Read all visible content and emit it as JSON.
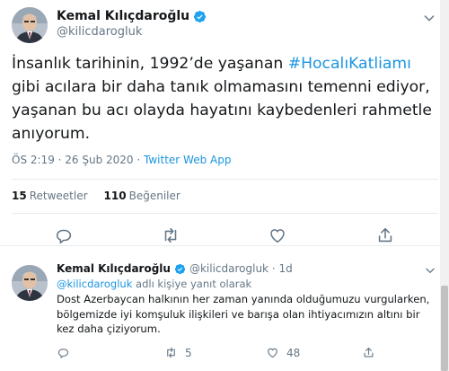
{
  "tweet": {
    "display_name": "Kemal Kılıçdaroğlu",
    "handle": "@kilicdarogluk",
    "text_before": "İnsanlık tarihinin, 1992’de yaşanan ",
    "hashtag": "#HocalıKatliamı",
    "text_after": " gibi acılara bir daha tanık olmamasını temenni ediyor, yaşanan bu acı olayda hayatını kaybedenleri rahmetle anıyorum.",
    "timestamp": "ÖS 2:19 · 26 Şub 2020 · ",
    "source": "Twitter Web App",
    "retweets_count": "15",
    "retweets_label": "Retweetler",
    "likes_count": "110",
    "likes_label": "Beğeniler",
    "verified_color": "#1da1f2",
    "icons": [
      "reply-icon",
      "retweet-icon",
      "like-icon",
      "share-icon",
      "chevron-down-icon",
      "verified-badge-icon"
    ]
  },
  "reply": {
    "display_name": "Kemal Kılıçdaroğlu",
    "handle": "@kilicdarogluk · 1d",
    "replying_link": "@kilicdarogluk",
    "replying_suffix": " adlı kişiye yanıt olarak",
    "text": "Dost Azerbaycan halkının her zaman yanında olduğumuzu vurgularken, bölgemizde iyi komşuluk ilişkileri ve barışa olan ihtiyacımızın altını bir kez daha çiziyorum.",
    "reply_count": "",
    "retweet_count": "5",
    "like_count": "48"
  }
}
